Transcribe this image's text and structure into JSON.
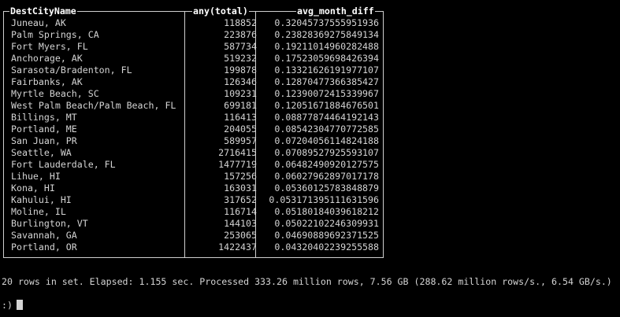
{
  "table": {
    "headers": [
      "DestCityName",
      "any(total)",
      "avg_month_diff"
    ],
    "rows": [
      [
        "Juneau, AK",
        "118852",
        "0.32045737555951936"
      ],
      [
        "Palm Springs, CA",
        "223876",
        "0.23828369275849134"
      ],
      [
        "Fort Myers, FL",
        "587734",
        "0.19211014960282488"
      ],
      [
        "Anchorage, AK",
        "519232",
        "0.17523059698426394"
      ],
      [
        "Sarasota/Bradenton, FL",
        "199878",
        "0.13321626191977107"
      ],
      [
        "Fairbanks, AK",
        "126346",
        "0.12870477366385427"
      ],
      [
        "Myrtle Beach, SC",
        "109231",
        "0.12390072415339967"
      ],
      [
        "West Palm Beach/Palm Beach, FL",
        "699181",
        "0.12051671884676501"
      ],
      [
        "Billings, MT",
        "116413",
        "0.08877874464192143"
      ],
      [
        "Portland, ME",
        "204055",
        "0.08542304770772585"
      ],
      [
        "San Juan, PR",
        "589957",
        "0.07204056114824188"
      ],
      [
        "Seattle, WA",
        "2716415",
        "0.07089527925593107"
      ],
      [
        "Fort Lauderdale, FL",
        "1477719",
        "0.06482490920127575"
      ],
      [
        "Lihue, HI",
        "157256",
        "0.06027962897017178"
      ],
      [
        "Kona, HI",
        "163031",
        "0.05360125783848879"
      ],
      [
        "Kahului, HI",
        "317652",
        "0.053171395111631596"
      ],
      [
        "Moline, IL",
        "116714",
        "0.05180184039618212"
      ],
      [
        "Burlington, VT",
        "144103",
        "0.05022102246309931"
      ],
      [
        "Savannah, GA",
        "253065",
        "0.04690889692371525"
      ],
      [
        "Portland, OR",
        "1422437",
        "0.04320402239255588"
      ]
    ]
  },
  "status": "20 rows in set. Elapsed: 1.155 sec. Processed 333.26 million rows, 7.56 GB (288.62 million rows/s., 6.54 GB/s.)",
  "prompt": ":)",
  "colors": {
    "background": "#000000",
    "text": "#d4d4d4",
    "header": "#ffffff",
    "border": "#cfcfcf"
  }
}
